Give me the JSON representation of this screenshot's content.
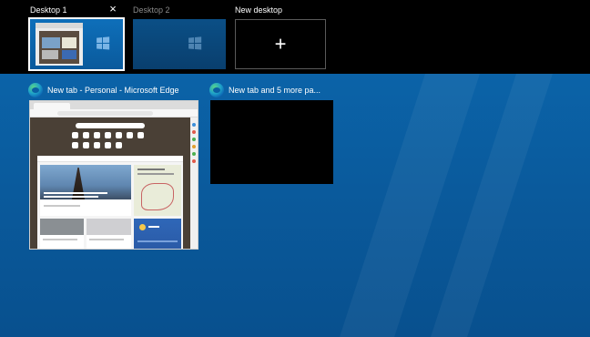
{
  "desktops": [
    {
      "label": "Desktop 1",
      "active": true,
      "close_glyph": "×"
    },
    {
      "label": "Desktop 2",
      "active": false
    }
  ],
  "new_desktop": {
    "label": "New desktop",
    "plus_glyph": "+"
  },
  "windows": [
    {
      "title": "New tab - Personal - Microsoft Edge",
      "icon": "edge-icon"
    },
    {
      "title": "New tab and 5 more pa...",
      "icon": "edge-icon"
    }
  ],
  "colors": {
    "bar_bg": "#000000",
    "wallpaper": "#0a5fa3",
    "active_outline": "#ffffff",
    "inactive_label": "#8a8a8a"
  }
}
